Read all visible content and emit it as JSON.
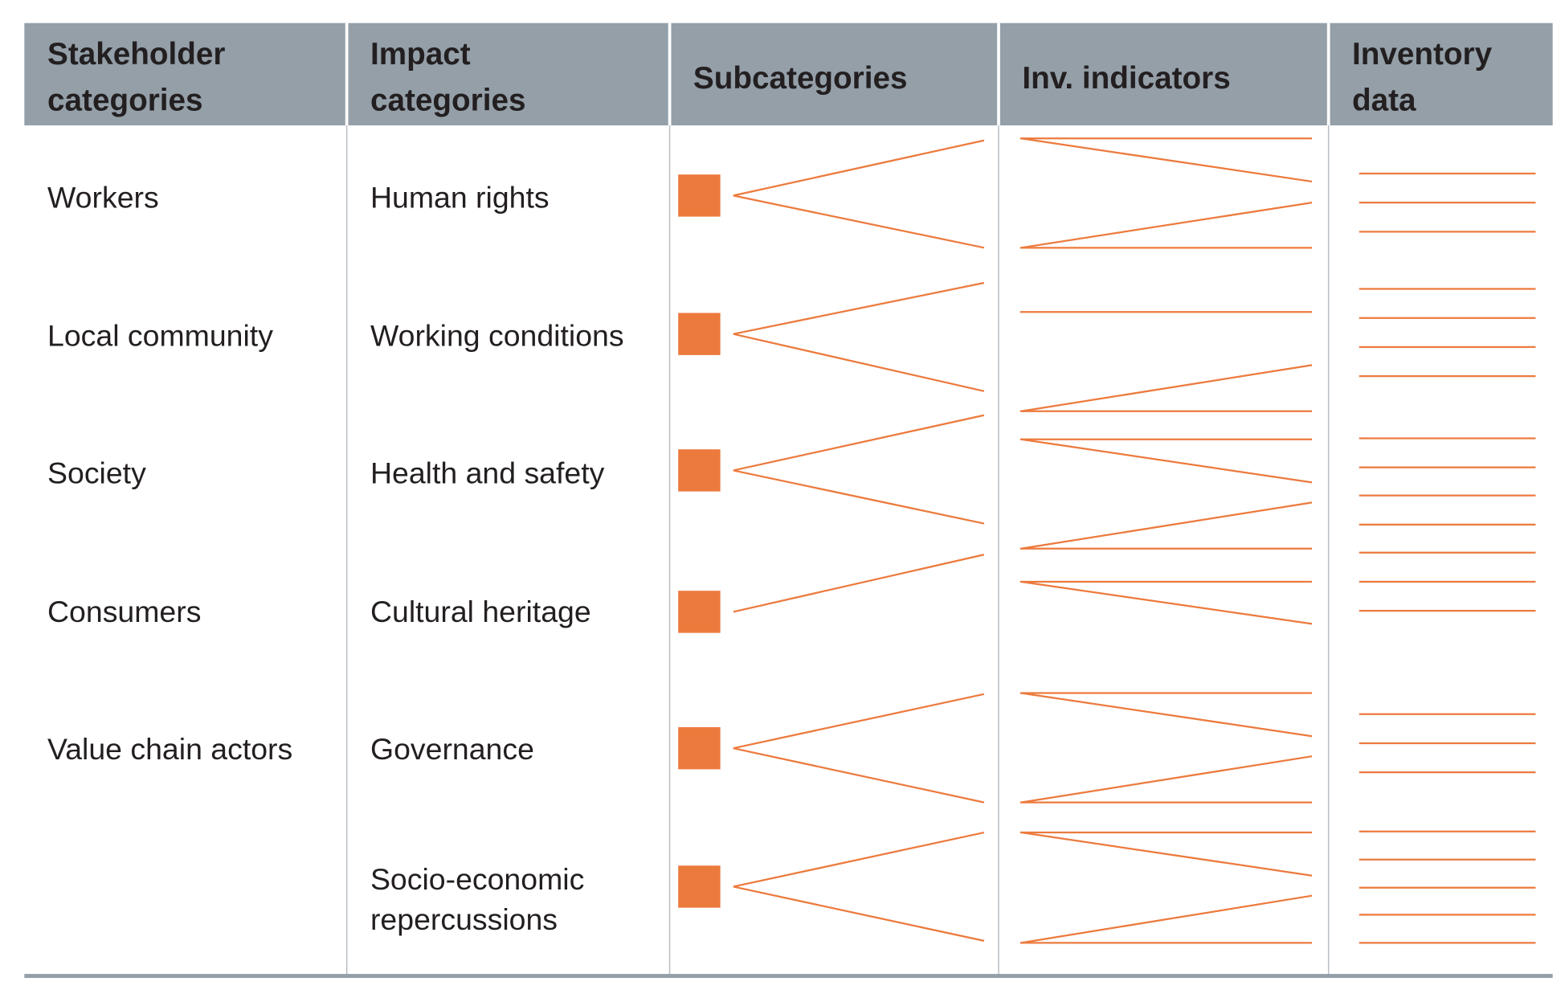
{
  "colors": {
    "header_bg": "#949fa8",
    "accent": "#ec7a3d",
    "text": "#231f20",
    "divider": "#b7bec4"
  },
  "headers": [
    {
      "lines": [
        "Stakeholder",
        "categories"
      ]
    },
    {
      "lines": [
        "Impact",
        "categories"
      ]
    },
    {
      "lines": [
        "Subcategories"
      ]
    },
    {
      "lines": [
        "Inv. indicators"
      ]
    },
    {
      "lines": [
        "Inventory",
        "data"
      ]
    }
  ],
  "stakeholder_categories": [
    "Workers",
    "Local community",
    "Society",
    "Consumers",
    "Value chain actors"
  ],
  "impact_categories": [
    {
      "lines": [
        "Human rights"
      ]
    },
    {
      "lines": [
        "Working conditions"
      ]
    },
    {
      "lines": [
        "Health and safety"
      ]
    },
    {
      "lines": [
        "Cultural heritage"
      ]
    },
    {
      "lines": [
        "Governance"
      ]
    },
    {
      "lines": [
        "Socio-economic",
        "repercussions"
      ]
    }
  ]
}
